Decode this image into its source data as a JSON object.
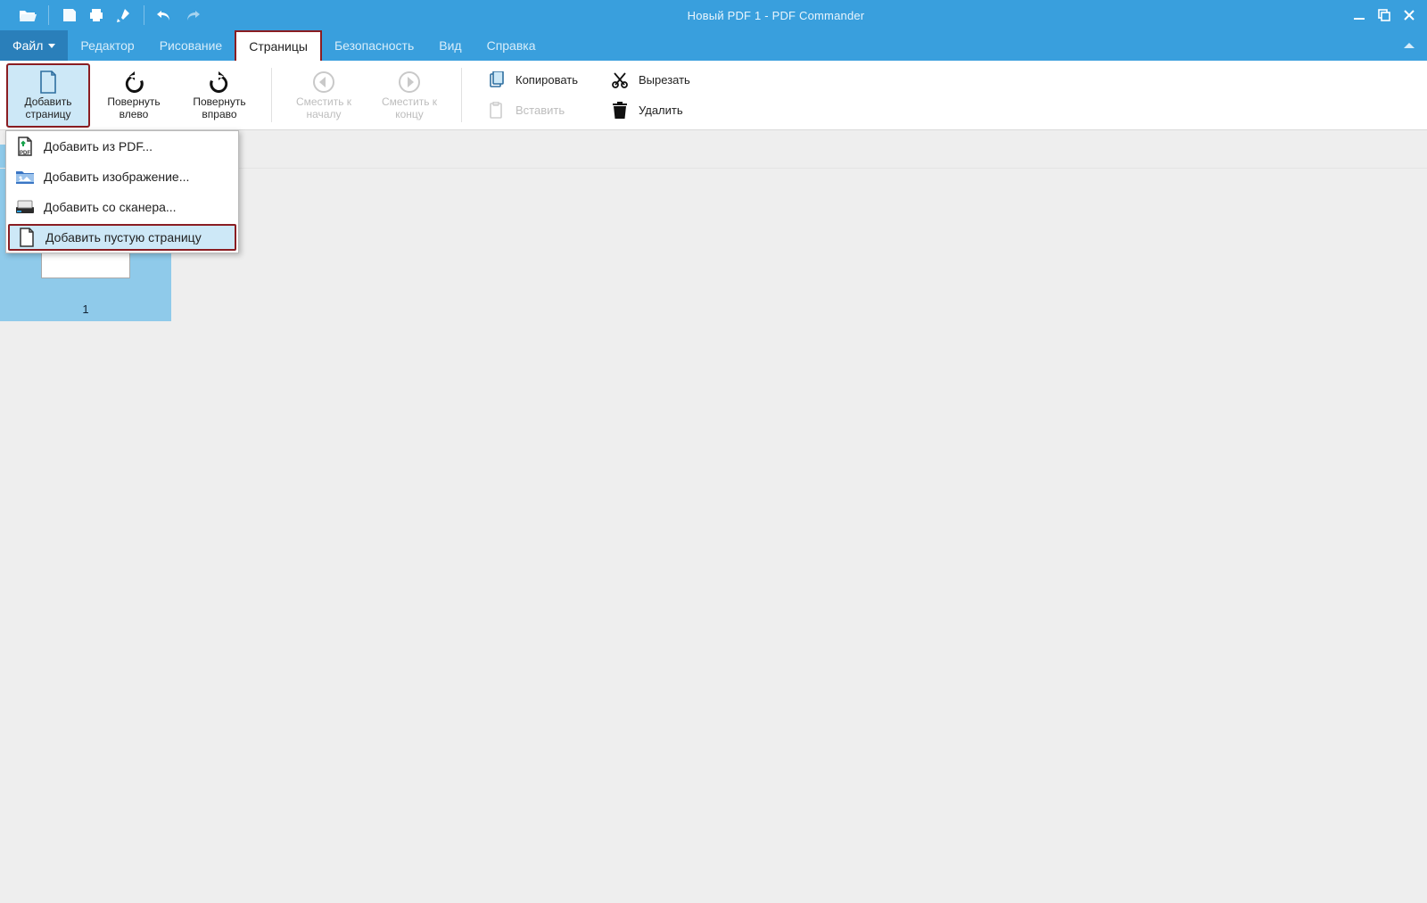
{
  "window": {
    "title": "Новый PDF 1 - PDF Commander"
  },
  "menu": {
    "file": "Файл",
    "editor": "Редактор",
    "drawing": "Рисование",
    "pages": "Страницы",
    "security": "Безопасность",
    "view": "Вид",
    "help": "Справка"
  },
  "ribbon": {
    "add_page_l1": "Добавить",
    "add_page_l2": "страницу",
    "rotate_left_l1": "Повернуть",
    "rotate_left_l2": "влево",
    "rotate_right_l1": "Повернуть",
    "rotate_right_l2": "вправо",
    "move_start_l1": "Сместить к",
    "move_start_l2": "началу",
    "move_end_l1": "Сместить к",
    "move_end_l2": "концу",
    "copy": "Копировать",
    "paste": "Вставить",
    "cut": "Вырезать",
    "delete": "Удалить"
  },
  "dropdown": {
    "add_from_pdf": "Добавить из PDF...",
    "add_image": "Добавить изображение...",
    "add_scanner": "Добавить со сканера...",
    "add_blank": "Добавить пустую страницу"
  },
  "thumbs": {
    "page1": "1"
  }
}
